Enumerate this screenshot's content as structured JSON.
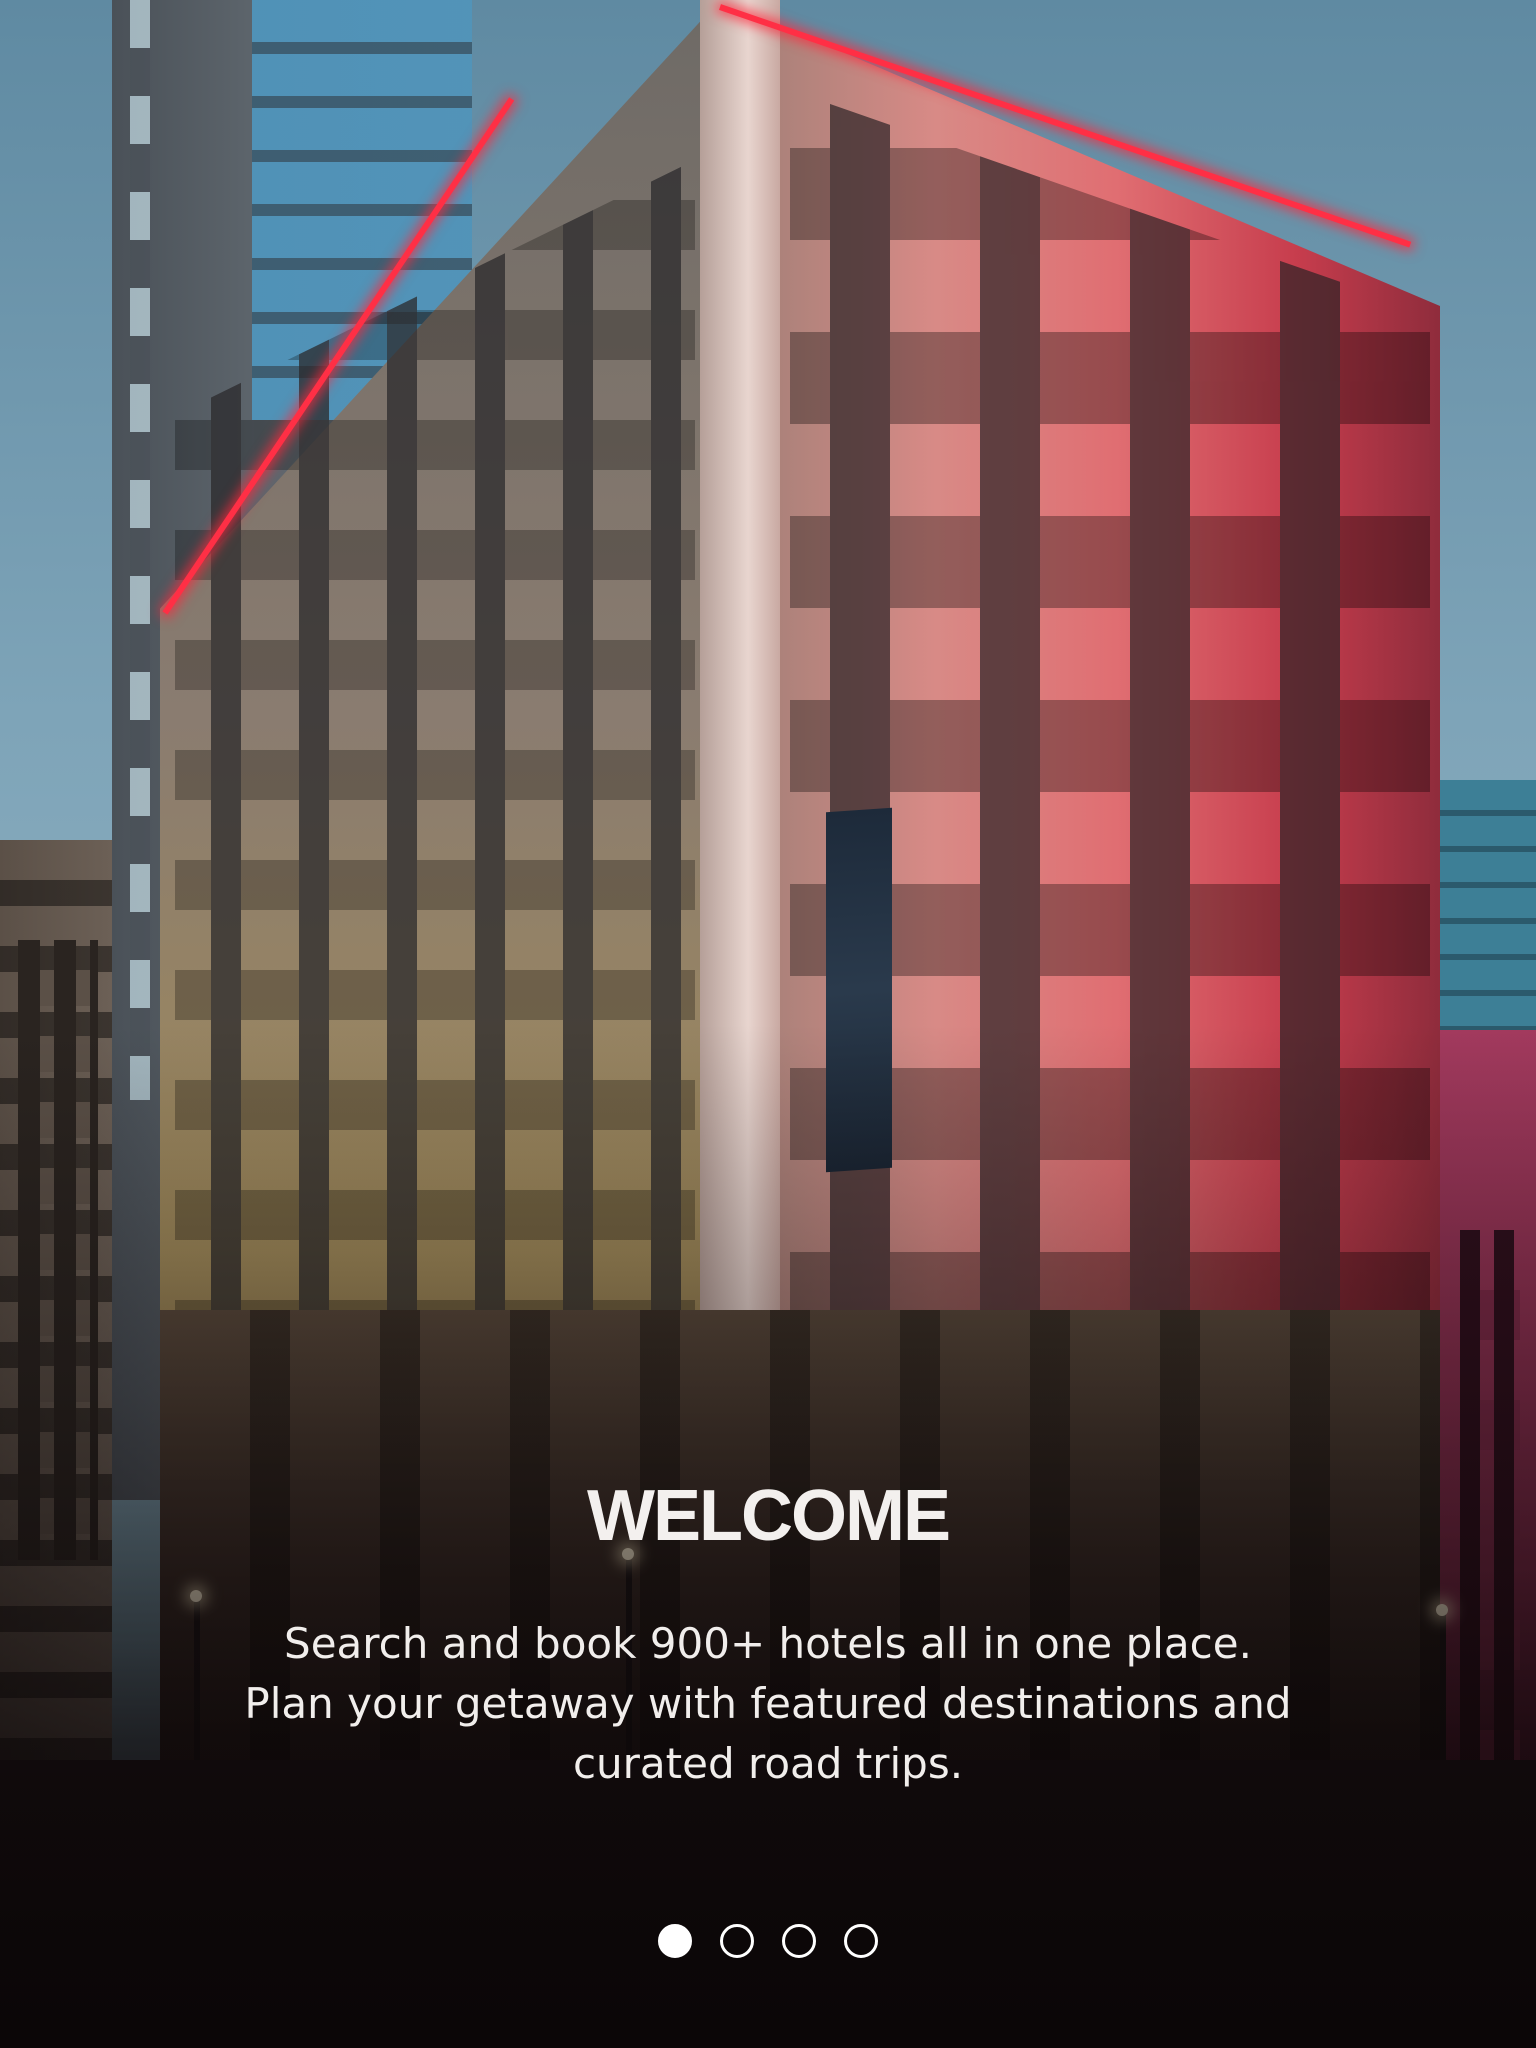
{
  "onboarding": {
    "title": "WELCOME",
    "description": "Search and book 900+ hotels all in one place. Plan your getaway with featured destinations and curated road trips."
  },
  "pager": {
    "total_pages": 4,
    "current_page": 1
  },
  "background": {
    "subject": "hotel building at dusk with red accent lighting",
    "accent_color": "#ff2f45"
  }
}
